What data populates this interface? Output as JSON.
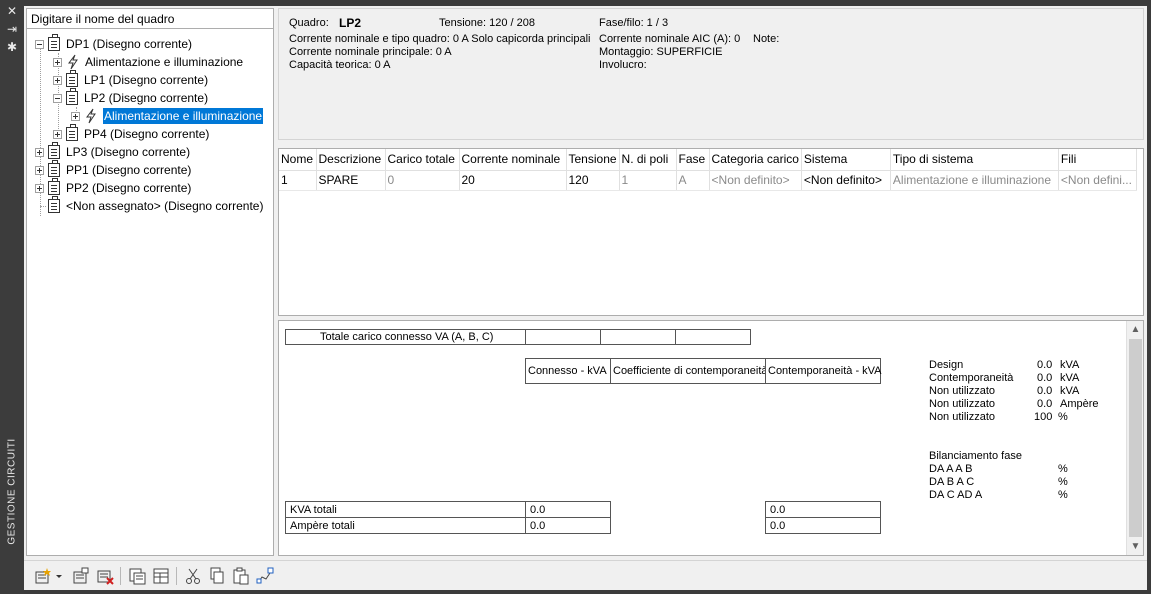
{
  "palette": {
    "title": "GESTIONE CIRCUITI"
  },
  "tree": {
    "search_placeholder": "Digitare il nome del quadro",
    "nodes": [
      {
        "label": "DP1 (Disegno corrente)",
        "type": "panel"
      },
      {
        "label": "Alimentazione e illuminazione",
        "type": "system"
      },
      {
        "label": "LP1 (Disegno corrente)",
        "type": "panel"
      },
      {
        "label": "LP2 (Disegno corrente)",
        "type": "panel"
      },
      {
        "label": "Alimentazione e illuminazione",
        "type": "system",
        "selected": true
      },
      {
        "label": "PP4 (Disegno corrente)",
        "type": "panel"
      },
      {
        "label": "LP3 (Disegno corrente)",
        "type": "panel"
      },
      {
        "label": "PP1 (Disegno corrente)",
        "type": "panel"
      },
      {
        "label": "PP2 (Disegno corrente)",
        "type": "panel"
      },
      {
        "label": "<Non assegnato> (Disegno corrente)",
        "type": "panel"
      }
    ]
  },
  "info": {
    "quadro_label": "Quadro:",
    "quadro_value": "LP2",
    "tensione": "Tensione: 120 / 208",
    "fase_filo": "Fase/filo:  1 /  3",
    "corrente_tipo": "Corrente nominale e tipo quadro: 0 A Solo capicorda principali",
    "corrente_aic": "Corrente nominale AIC (A):  0",
    "note": "Note:",
    "corrente_principale": "Corrente nominale principale: 0 A",
    "montaggio": "Montaggio:  SUPERFICIE",
    "capacita": "Capacità teorica: 0 A",
    "involucro": "Involucro:"
  },
  "grid": {
    "columns": [
      "Nome",
      "Descrizione",
      "Carico totale",
      "Corrente nominale",
      "Tensione",
      "N. di poli",
      "Fase",
      "Categoria carico",
      "Sistema",
      "Tipo di sistema",
      "Fili"
    ],
    "rows": [
      [
        "1",
        "SPARE",
        "0",
        "20",
        "120",
        "1",
        "A",
        "<Non definito>",
        "<Non definito>",
        "Alimentazione e illuminazione",
        "<Non defini..."
      ]
    ]
  },
  "summary": {
    "totale_carico": "Totale carico connesso VA (A, B, C)",
    "col_connesso": "Connesso - kVA",
    "col_coeff": "Coefficiente di contemporaneità",
    "col_contemp": "Contemporaneità - kVA",
    "kva_totali": "KVA totali",
    "ampere_totali": "Ampère totali",
    "kva_connesso": "0.0",
    "amp_connesso": "0.0",
    "kva_contemp": "0.0",
    "amp_contemp": "0.0",
    "stats": [
      {
        "label": "Design",
        "value": "0.0",
        "unit": "kVA"
      },
      {
        "label": "Contemporaneità",
        "value": "0.0",
        "unit": "kVA"
      },
      {
        "label": "Non utilizzato",
        "value": "0.0",
        "unit": "kVA"
      },
      {
        "label": "Non utilizzato",
        "value": "0.0",
        "unit": "Ampère"
      },
      {
        "label": "Non utilizzato",
        "value": "100",
        "unit": "%"
      }
    ],
    "bilanciamento_title": "Bilanciamento fase",
    "bilanciamento": [
      {
        "label": "DA A A B",
        "unit": "%"
      },
      {
        "label": "DA B A C",
        "unit": "%"
      },
      {
        "label": "DA C AD A",
        "unit": "%"
      }
    ]
  },
  "toolbar": {
    "icons": [
      "new-panel-icon",
      "dropdown-arrow-icon",
      "panel-properties-icon",
      "delete-panel-icon",
      "copy-schedule-icon",
      "schedule-icon",
      "cut-icon",
      "copy-icon",
      "paste-icon",
      "wire-icon"
    ]
  },
  "colors": {
    "selection": "#0078d7",
    "strip": "#3c3c3c"
  }
}
